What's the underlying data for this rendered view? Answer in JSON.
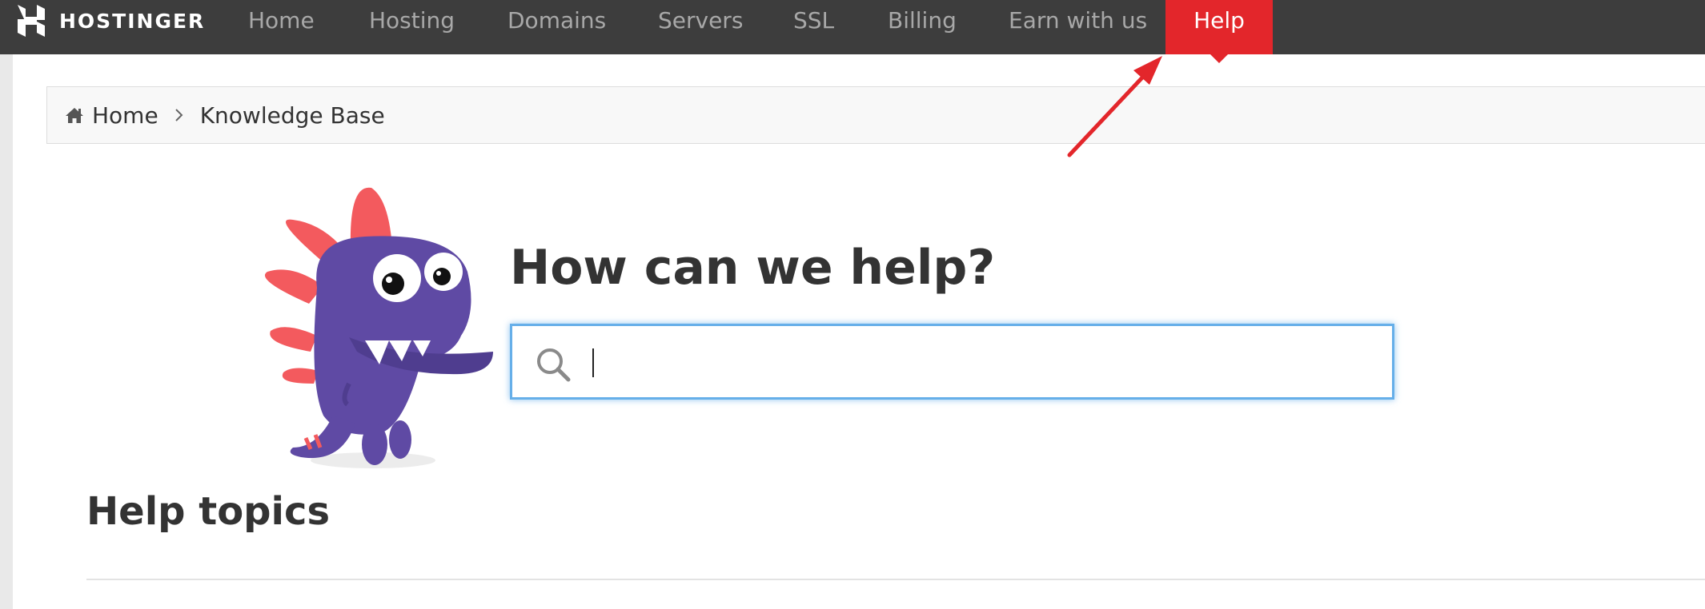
{
  "brand": {
    "name": "HOSTINGER",
    "color": "#ffffff"
  },
  "nav": {
    "items": [
      {
        "label": "Home"
      },
      {
        "label": "Hosting"
      },
      {
        "label": "Domains"
      },
      {
        "label": "Servers"
      },
      {
        "label": "SSL"
      },
      {
        "label": "Billing"
      },
      {
        "label": "Earn with us"
      },
      {
        "label": "Help",
        "active": true
      }
    ],
    "background": "#3d3d3d",
    "active_color": "#e3262b"
  },
  "breadcrumb": {
    "icon": "home-icon",
    "home": "Home",
    "separator_icon": "chevron-right-icon",
    "current": "Knowledge Base"
  },
  "hero": {
    "title": "How can we help?",
    "mascot": "purple-dinosaur-mascot"
  },
  "search": {
    "icon": "search-icon",
    "value": "",
    "placeholder": "",
    "focus_color": "#66afe9"
  },
  "topics": {
    "title": "Help topics"
  },
  "annotation": {
    "type": "red-arrow",
    "target": "Help",
    "color": "#e3262b"
  }
}
